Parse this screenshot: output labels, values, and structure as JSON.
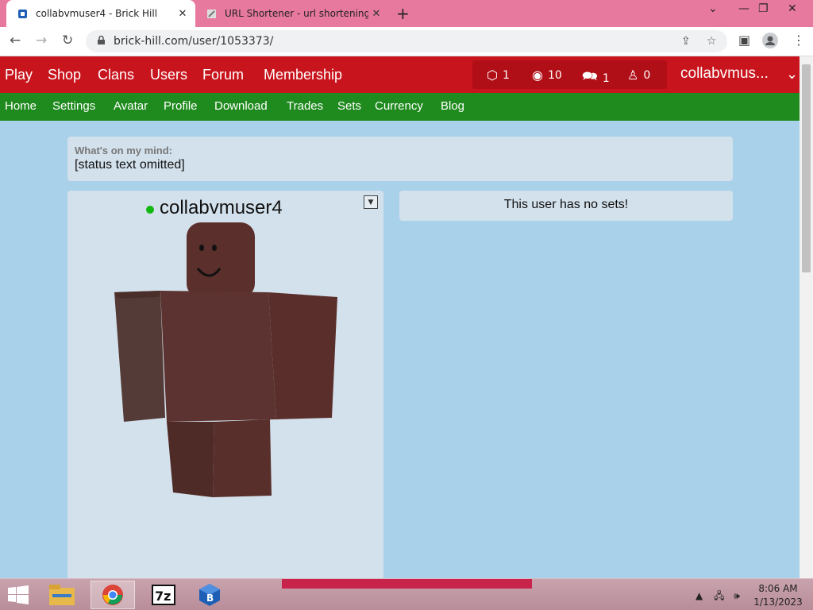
{
  "browser": {
    "tabs": [
      {
        "title": "collabvmuser4 - Brick Hill",
        "active": true
      },
      {
        "title": "URL Shortener - url shortening s",
        "active": false
      }
    ],
    "url": "brick-hill.com/user/1053373/",
    "new_tab": "+"
  },
  "site": {
    "main_nav": [
      "Play",
      "Shop",
      "Clans",
      "Users",
      "Forum",
      "Membership"
    ],
    "stats": {
      "bricks": "1",
      "bits": "10",
      "messages": "1",
      "friend_requests": "0"
    },
    "username": "collabvmus...",
    "sub_nav": [
      "Home",
      "Settings",
      "Avatar",
      "Profile",
      "Download",
      "Trades",
      "Sets",
      "Currency",
      "Blog"
    ]
  },
  "profile": {
    "mind_label": "What's on my mind:",
    "mind_text": "[status text omitted]",
    "name": "collabvmuser4",
    "online": true,
    "no_sets": "This user has no sets!"
  },
  "taskbar": {
    "time": "8:06 AM",
    "date": "1/13/2023"
  },
  "colors": {
    "tab_strip": "#e8799e",
    "nav_red": "#c8141d",
    "nav_green": "#1f8a1d",
    "page_bg": "#a9d1ea",
    "card_bg": "#d3e1ec",
    "avatar": "#5a2e2a",
    "online": "#12b812"
  }
}
